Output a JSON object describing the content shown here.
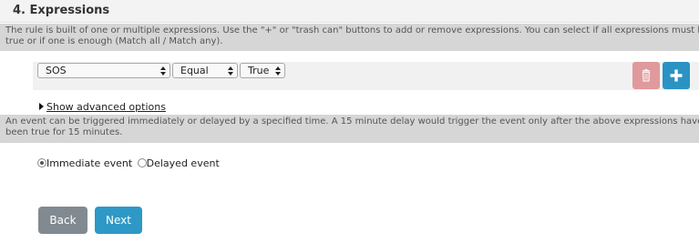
{
  "section": {
    "title": "4. Expressions"
  },
  "expressions_info": {
    "line1": "The rule is built of one or multiple expressions. Use the \"+\" or \"trash can\" buttons to add or remove expressions. You can select if all expressions must be",
    "line2": "true or if one is enough (Match all / Match any)."
  },
  "expression": {
    "sensor": "SOS",
    "operator": "Equal",
    "value": "True"
  },
  "advanced": {
    "label": "Show advanced options"
  },
  "event_info": {
    "line1": "An event can be triggered immediately or delayed by a specified time. A 15 minute delay would trigger the event only after the above expressions have",
    "line2": "been true for 15 minutes."
  },
  "event_type": {
    "options": [
      "Immediate event",
      "Delayed event"
    ],
    "selected": "Immediate event"
  },
  "nav": {
    "back": "Back",
    "next": "Next"
  },
  "colors": {
    "add_button": "#2a93c3",
    "delete_button": "#e09a9c",
    "back_button": "#818a91",
    "next_button": "#2e98c6"
  },
  "icons": {
    "delete": "trash-icon",
    "add": "plus-icon",
    "advanced": "triangle-right-icon"
  }
}
